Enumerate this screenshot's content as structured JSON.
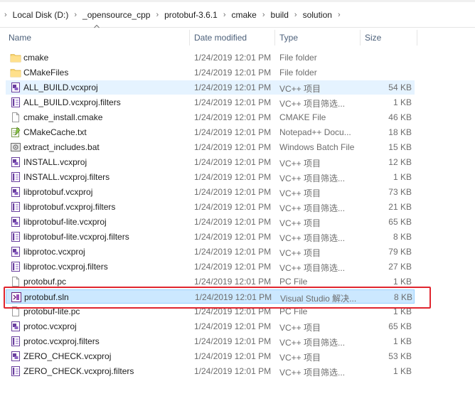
{
  "breadcrumb": [
    "Local Disk (D:)",
    "_opensource_cpp",
    "protobuf-3.6.1",
    "cmake",
    "build",
    "solution"
  ],
  "columns": {
    "name": "Name",
    "date": "Date modified",
    "type": "Type",
    "size": "Size"
  },
  "files": [
    {
      "name": "cmake",
      "date": "1/24/2019 12:01 PM",
      "type": "File folder",
      "size": "",
      "icon": "folder-icon"
    },
    {
      "name": "CMakeFiles",
      "date": "1/24/2019 12:01 PM",
      "type": "File folder",
      "size": "",
      "icon": "folder-icon"
    },
    {
      "name": "ALL_BUILD.vcxproj",
      "date": "1/24/2019 12:01 PM",
      "type": "VC++ 项目",
      "size": "54 KB",
      "icon": "vcxproj-icon"
    },
    {
      "name": "ALL_BUILD.vcxproj.filters",
      "date": "1/24/2019 12:01 PM",
      "type": "VC++ 项目筛选...",
      "size": "1 KB",
      "icon": "filters-icon"
    },
    {
      "name": "cmake_install.cmake",
      "date": "1/24/2019 12:01 PM",
      "type": "CMAKE File",
      "size": "46 KB",
      "icon": "file-icon"
    },
    {
      "name": "CMakeCache.txt",
      "date": "1/24/2019 12:01 PM",
      "type": "Notepad++ Docu...",
      "size": "18 KB",
      "icon": "notepad-icon"
    },
    {
      "name": "extract_includes.bat",
      "date": "1/24/2019 12:01 PM",
      "type": "Windows Batch File",
      "size": "15 KB",
      "icon": "batch-icon"
    },
    {
      "name": "INSTALL.vcxproj",
      "date": "1/24/2019 12:01 PM",
      "type": "VC++ 项目",
      "size": "12 KB",
      "icon": "vcxproj-icon"
    },
    {
      "name": "INSTALL.vcxproj.filters",
      "date": "1/24/2019 12:01 PM",
      "type": "VC++ 项目筛选...",
      "size": "1 KB",
      "icon": "filters-icon"
    },
    {
      "name": "libprotobuf.vcxproj",
      "date": "1/24/2019 12:01 PM",
      "type": "VC++ 项目",
      "size": "73 KB",
      "icon": "vcxproj-icon"
    },
    {
      "name": "libprotobuf.vcxproj.filters",
      "date": "1/24/2019 12:01 PM",
      "type": "VC++ 项目筛选...",
      "size": "21 KB",
      "icon": "filters-icon"
    },
    {
      "name": "libprotobuf-lite.vcxproj",
      "date": "1/24/2019 12:01 PM",
      "type": "VC++ 项目",
      "size": "65 KB",
      "icon": "vcxproj-icon"
    },
    {
      "name": "libprotobuf-lite.vcxproj.filters",
      "date": "1/24/2019 12:01 PM",
      "type": "VC++ 项目筛选...",
      "size": "8 KB",
      "icon": "filters-icon"
    },
    {
      "name": "libprotoc.vcxproj",
      "date": "1/24/2019 12:01 PM",
      "type": "VC++ 项目",
      "size": "79 KB",
      "icon": "vcxproj-icon"
    },
    {
      "name": "libprotoc.vcxproj.filters",
      "date": "1/24/2019 12:01 PM",
      "type": "VC++ 项目筛选...",
      "size": "27 KB",
      "icon": "filters-icon"
    },
    {
      "name": "protobuf.pc",
      "date": "1/24/2019 12:01 PM",
      "type": "PC File",
      "size": "1 KB",
      "icon": "file-icon"
    },
    {
      "name": "protobuf.sln",
      "date": "1/24/2019 12:01 PM",
      "type": "Visual Studio 解决...",
      "size": "8 KB",
      "icon": "sln-icon"
    },
    {
      "name": "protobuf-lite.pc",
      "date": "1/24/2019 12:01 PM",
      "type": "PC File",
      "size": "1 KB",
      "icon": "file-icon"
    },
    {
      "name": "protoc.vcxproj",
      "date": "1/24/2019 12:01 PM",
      "type": "VC++ 项目",
      "size": "65 KB",
      "icon": "vcxproj-icon"
    },
    {
      "name": "protoc.vcxproj.filters",
      "date": "1/24/2019 12:01 PM",
      "type": "VC++ 项目筛选...",
      "size": "1 KB",
      "icon": "filters-icon"
    },
    {
      "name": "ZERO_CHECK.vcxproj",
      "date": "1/24/2019 12:01 PM",
      "type": "VC++ 项目",
      "size": "53 KB",
      "icon": "vcxproj-icon"
    },
    {
      "name": "ZERO_CHECK.vcxproj.filters",
      "date": "1/24/2019 12:01 PM",
      "type": "VC++ 项目筛选...",
      "size": "1 KB",
      "icon": "filters-icon"
    }
  ],
  "hovered_file": "ALL_BUILD.vcxproj",
  "selected_file": "protobuf.sln",
  "colors": {
    "accent": "#e0262f",
    "selection": "#cce8ff",
    "hover": "#e5f3ff",
    "folder": "#f8d775"
  }
}
